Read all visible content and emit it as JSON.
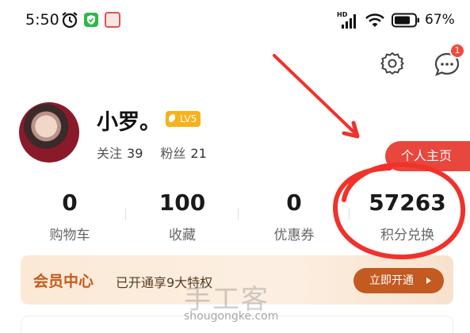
{
  "status_bar": {
    "time": "5:50",
    "network": "HD",
    "battery": "67%"
  },
  "header": {
    "message_badge": "1"
  },
  "profile": {
    "name": "小罗。",
    "level": "LV5",
    "following_label": "关注",
    "following_count": "39",
    "followers_label": "粉丝",
    "followers_count": "21",
    "homepage_tab": "个人主页"
  },
  "stats": [
    {
      "value": "0",
      "label": "购物车"
    },
    {
      "value": "100",
      "label": "收藏"
    },
    {
      "value": "0",
      "label": "优惠券"
    },
    {
      "value": "57263",
      "label": "积分兑换"
    }
  ],
  "vip": {
    "title": "会员中心",
    "description": "已开通享9大特权",
    "button": "立即开通"
  },
  "watermark": {
    "brand": "手工客",
    "url": "shougongke.com"
  },
  "colors": {
    "accent_red": "#e8473d",
    "annotation_red": "#f0322a",
    "level_gold": "#f6b21a",
    "vip_brown": "#c25a21"
  },
  "icons": [
    "alarm-icon",
    "shield-app-icon",
    "app-icon",
    "signal-icon",
    "wifi-icon",
    "battery-icon",
    "gear-icon",
    "chat-bubble-icon",
    "moon-icon",
    "chevron-right-icon"
  ]
}
